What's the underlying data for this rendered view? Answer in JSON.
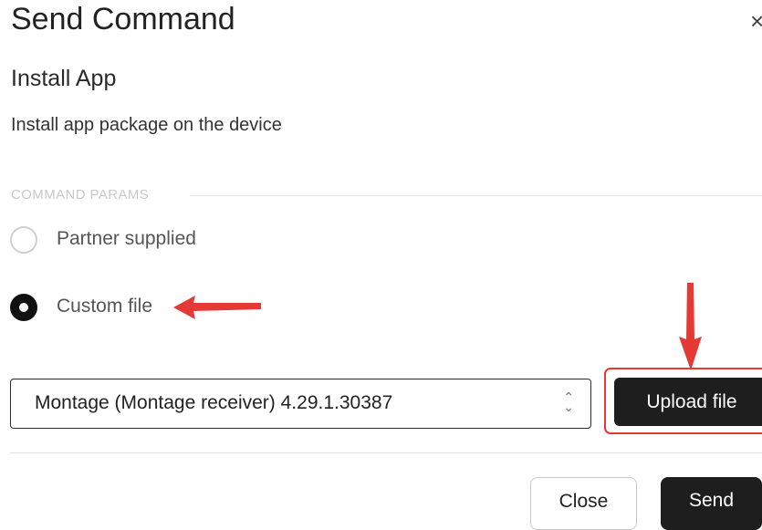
{
  "dialog": {
    "title": "Send Command",
    "close_glyph": "×",
    "command_name": "Install App",
    "command_description": "Install app package on the device"
  },
  "params": {
    "section_label": "COMMAND PARAMS",
    "options": [
      {
        "label": "Partner supplied",
        "selected": false
      },
      {
        "label": "Custom file",
        "selected": true
      }
    ]
  },
  "file_select": {
    "value": "Montage (Montage receiver) 4.29.1.30387",
    "up_glyph": "⌃",
    "down_glyph": "⌄"
  },
  "upload_button": {
    "label": "Upload file"
  },
  "footer": {
    "close_label": "Close",
    "send_label": "Send"
  },
  "annotations": {
    "color": "#e53935",
    "highlight": "upload-button"
  }
}
